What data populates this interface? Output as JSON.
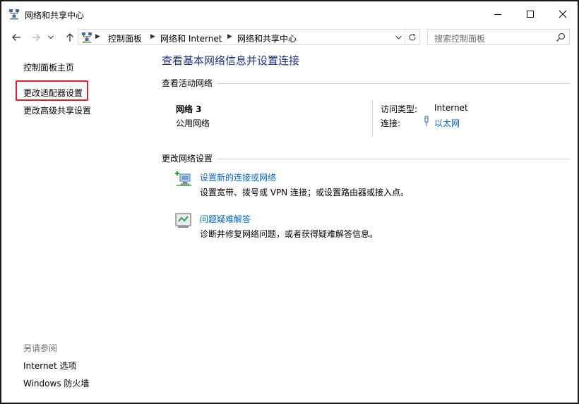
{
  "window": {
    "title": "网络和共享中心"
  },
  "address_bar": {
    "crumbs": [
      "控制面板",
      "网络和 Internet",
      "网络和共享中心"
    ]
  },
  "search": {
    "placeholder": "搜索控制面板"
  },
  "left_pane": {
    "home": "控制面板主页",
    "change_adapter": "更改适配器设置",
    "change_advanced": "更改高级共享设置",
    "see_also_title": "另请参阅",
    "see_also": [
      "Internet 选项",
      "Windows 防火墙"
    ]
  },
  "main": {
    "title": "查看基本网络信息并设置连接",
    "active_networks_label": "查看活动网络",
    "network": {
      "name": "网络 3",
      "profile": "公用网络",
      "access_type_label": "访问类型:",
      "access_type_value": "Internet",
      "connection_label": "连接:",
      "connection_value": "以太网"
    },
    "change_settings_label": "更改网络设置",
    "tasks": [
      {
        "title": "设置新的连接或网络",
        "description": "设置宽带、拨号或 VPN 连接；或设置路由器或接入点。",
        "icon": "new-connection-icon"
      },
      {
        "title": "问题疑难解答",
        "description": "诊断并修复网络问题，或者获得疑难解答信息。",
        "icon": "troubleshoot-icon"
      }
    ]
  },
  "colors": {
    "link": "#0066cc",
    "title": "#1e3287",
    "highlight": "#e02020"
  }
}
